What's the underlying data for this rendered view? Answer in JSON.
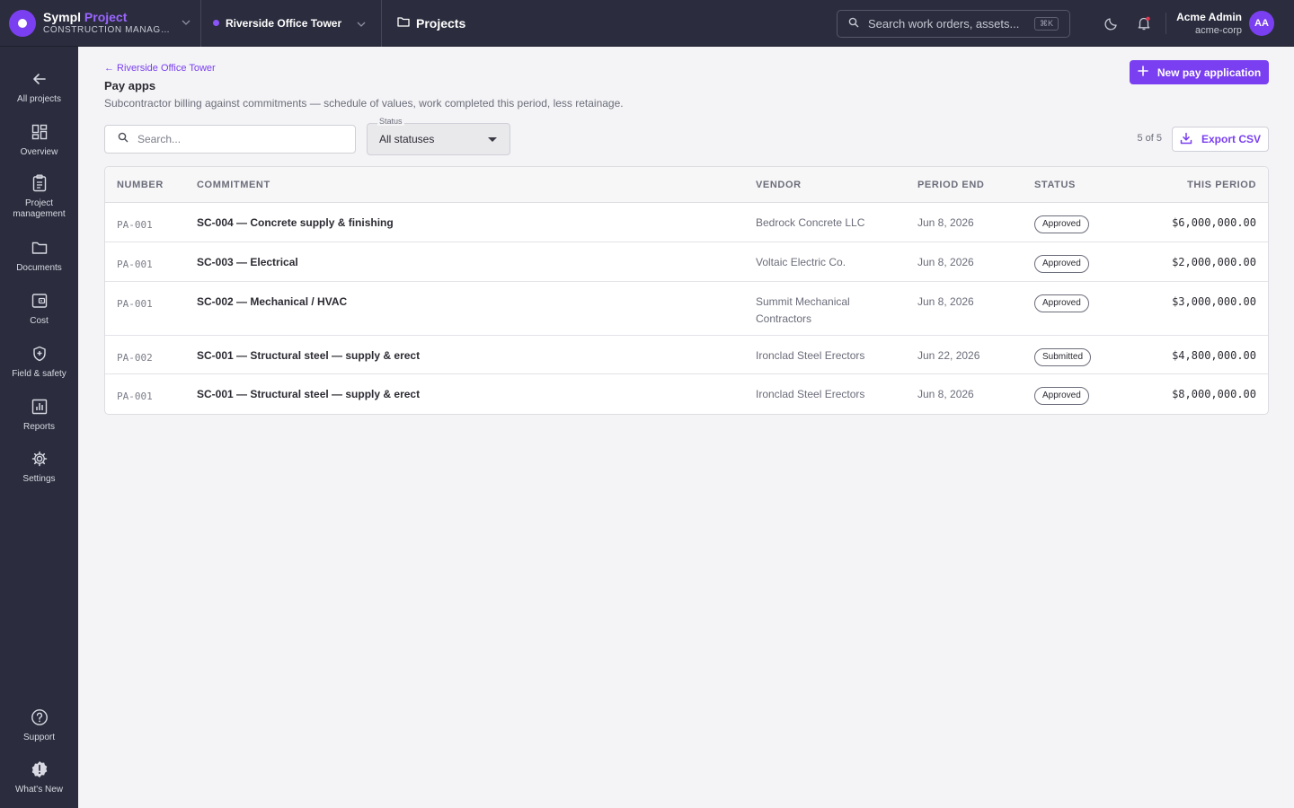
{
  "brand": {
    "name": "Sympl",
    "name_accent": "Project",
    "subtitle": "CONSTRUCTION MANAGEM..."
  },
  "project_switcher": {
    "name": "Riverside Office Tower"
  },
  "breadcrumb": {
    "label": "Projects"
  },
  "search": {
    "placeholder": "Search work orders, assets...",
    "shortcut": "⌘K"
  },
  "user": {
    "name": "Acme Admin",
    "org": "acme-corp",
    "initials": "AA"
  },
  "sidebar": {
    "items": [
      {
        "label": "All projects",
        "icon": "arrow-left-icon"
      },
      {
        "label": "Overview",
        "icon": "grid-icon"
      },
      {
        "label": "Project management",
        "icon": "clipboard-icon"
      },
      {
        "label": "Documents",
        "icon": "folder-icon"
      },
      {
        "label": "Cost",
        "icon": "wallet-icon"
      },
      {
        "label": "Field & safety",
        "icon": "shield-icon"
      },
      {
        "label": "Reports",
        "icon": "bar-chart-icon"
      },
      {
        "label": "Settings",
        "icon": "gear-icon"
      }
    ],
    "footer": [
      {
        "label": "Support",
        "icon": "help-icon"
      },
      {
        "label": "What's New",
        "icon": "badge-alert-icon"
      }
    ]
  },
  "page": {
    "back_link": "← Riverside Office Tower",
    "title": "Pay apps",
    "description": "Subcontractor billing against commitments — schedule of values, work completed this period, less retainage.",
    "new_button": "New pay application"
  },
  "filters": {
    "search_placeholder": "Search...",
    "status_label": "Status",
    "status_value": "All statuses",
    "count": "5 of 5",
    "export_label": "Export CSV"
  },
  "table": {
    "headers": [
      "NUMBER",
      "COMMITMENT",
      "VENDOR",
      "PERIOD END",
      "STATUS",
      "THIS PERIOD"
    ],
    "rows": [
      {
        "number": "PA-001",
        "commitment": "SC-004 — Concrete supply & finishing",
        "vendor": "Bedrock Concrete LLC",
        "period_end": "Jun 8, 2026",
        "status": "Approved",
        "amount": "$6,000,000.00"
      },
      {
        "number": "PA-001",
        "commitment": "SC-003 — Electrical",
        "vendor": "Voltaic Electric Co.",
        "period_end": "Jun 8, 2026",
        "status": "Approved",
        "amount": "$2,000,000.00"
      },
      {
        "number": "PA-001",
        "commitment": "SC-002 — Mechanical / HVAC",
        "vendor": "Summit Mechanical Contractors",
        "period_end": "Jun 8, 2026",
        "status": "Approved",
        "amount": "$3,000,000.00"
      },
      {
        "number": "PA-002",
        "commitment": "SC-001 — Structural steel — supply & erect",
        "vendor": "Ironclad Steel Erectors",
        "period_end": "Jun 22, 2026",
        "status": "Submitted",
        "amount": "$4,800,000.00"
      },
      {
        "number": "PA-001",
        "commitment": "SC-001 — Structural steel — supply & erect",
        "vendor": "Ironclad Steel Erectors",
        "period_end": "Jun 8, 2026",
        "status": "Approved",
        "amount": "$8,000,000.00"
      }
    ]
  },
  "colors": {
    "accent": "#7a3ff0",
    "sidebar_bg": "#2b2d3e",
    "page_bg": "#f4f4f6"
  }
}
